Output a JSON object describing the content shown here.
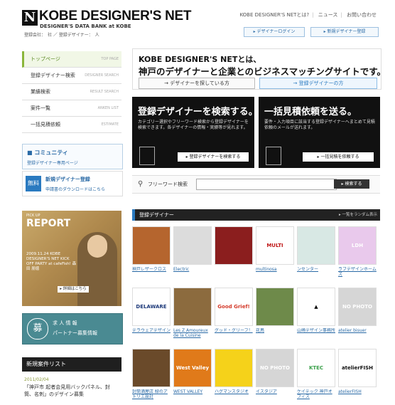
{
  "header": {
    "logo_mark": "N",
    "title": "KOBE DESIGNER'S NET",
    "subtitle": "DESIGNER'S DATA BANK at KOBE",
    "stats": "登録会社：　社 ／ 登録デザイナー：　人",
    "nav": [
      "KOBE DESIGNER'S NETとは?",
      "ニュース",
      "お問い合わせ"
    ],
    "login_button": "▸ デザイナーログイン",
    "register_button": "▸ 新規デザイナー登録"
  },
  "sidebar": {
    "items": [
      {
        "label": "トップページ",
        "en": "TOP PAGE",
        "active": true
      },
      {
        "label": "登録デザイナー検索",
        "en": "DESIGNER SEARCH",
        "active": false
      },
      {
        "label": "業績検索",
        "en": "RESULT SEARCH",
        "active": false
      },
      {
        "label": "案件一覧",
        "en": "ANKEN LIST",
        "active": false
      },
      {
        "label": "一括見積依頼",
        "en": "ESTIMATE",
        "active": false
      }
    ],
    "community_title": "コミュニティ",
    "community_link": "登録デザイナー専用ページ",
    "new_reg_icon": "無料",
    "new_reg_title": "新規デザイナー登録",
    "new_reg_link": "申請書のダウンロードはこちら",
    "report_pick": "PICK UP",
    "report_title": "REPORT",
    "report_info": "2009.11.24 KOBE DESIGNER'S NET KICK OFF PARTY at cafeFish! 森田 朋徳",
    "report_more": "▸ 詳細はこちら",
    "job_icon": "募",
    "job_line1": "求 人 情 報",
    "job_line2": "パートナー募集情報",
    "newcase_title": "新規案件リスト",
    "newcase_date": "2011/02/04",
    "newcase_text": "「神戸市 起者会見用バックパネル、封筒、名刺」のデザイン募集"
  },
  "intro": {
    "line1": "KOBE DESIGNER'S NETとは、",
    "line2": "神戸のデザイナーと企業とのビジネスマッチングサイトです。",
    "btn_left": "→ デザイナーを探している方",
    "btn_right": "→ 登録デザイナーの方"
  },
  "panels": {
    "search_title": "登録デザイナーを検索する。",
    "search_desc": "カテゴリー選択やフリーワード検索から登録デザイナーを検索できます。各デザイナーの情報・実績等が見れます。",
    "search_button": "▸ 登録デザイナーを検索する",
    "estimate_title": "一括見積依頼を送る。",
    "estimate_desc": "要件・入力項目に該当する登録デザイナーへまとめて見積依頼のメールが送れます。",
    "estimate_button": "▸ 一括見積を依頼する"
  },
  "search": {
    "label": "フリーワード検索",
    "placeholder": "",
    "button": "▸ 検索する"
  },
  "registered": {
    "title": "登録デザイナー",
    "right": "▸ 一覧をランダム表示",
    "designers": [
      {
        "name": "神戸レザークロス",
        "thumb": "",
        "bg": "#b5652e",
        "fg": "#ffffff"
      },
      {
        "name": "Electric",
        "thumb": "",
        "bg": "#dcdcdc",
        "fg": "#111111"
      },
      {
        "name": "",
        "thumb": "",
        "bg": "#8b1e1e",
        "fg": "#ffffff"
      },
      {
        "name": "multinosa",
        "thumb": "MULTI",
        "bg": "#ffffff",
        "fg": "#c01818"
      },
      {
        "name": "ンセンター",
        "thumb": "",
        "bg": "#d8e8e4",
        "fg": "#333333"
      },
      {
        "name": "ラブデザインホームズ",
        "thumb": "LDH",
        "bg": "#e9c9ec",
        "fg": "#ffffff"
      },
      {
        "name": "デラウェアデザイン",
        "thumb": "DELAWARE",
        "bg": "#ffffff",
        "fg": "#1e3a7a"
      },
      {
        "name": "Les Z Amoureux de la Cuisine",
        "thumb": "",
        "bg": "#8c6b3e",
        "fg": "#ffffff"
      },
      {
        "name": "グッド・グリーフ！",
        "thumb": "Good Grief!",
        "bg": "#ffffff",
        "fg": "#d43a2a"
      },
      {
        "name": "花鳥",
        "thumb": "",
        "bg": "#6e8a4a",
        "fg": "#ffffff"
      },
      {
        "name": "山崎デザイン事務所",
        "thumb": "▲",
        "bg": "#ffffff",
        "fg": "#111111"
      },
      {
        "name": "atelier bisuer",
        "thumb": "NO PHOTO",
        "bg": "#d6d6d6",
        "fg": "#ffffff"
      },
      {
        "name": "封筒酒屋店 緑のアトリエ設計",
        "thumb": "",
        "bg": "#6a4a2a",
        "fg": "#ffffff"
      },
      {
        "name": "WEST VALLEY",
        "thumb": "West Valley",
        "bg": "#e07a1a",
        "fg": "#ffffff"
      },
      {
        "name": "ハグマンスタジオ",
        "thumb": "",
        "bg": "#f5d21a",
        "fg": "#111111"
      },
      {
        "name": "イスタジア",
        "thumb": "NO PHOTO",
        "bg": "#d6d6d6",
        "fg": "#ffffff"
      },
      {
        "name": "ケイテック 神戸オフィス",
        "thumb": "KTEC",
        "bg": "#ffffff",
        "fg": "#3aa04a"
      },
      {
        "name": "atelierFISH",
        "thumb": "atelierFISH",
        "bg": "#ffffff",
        "fg": "#111111"
      }
    ]
  }
}
